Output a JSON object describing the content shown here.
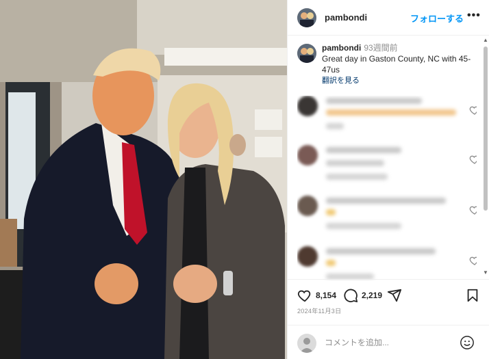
{
  "post": {
    "username": "pambondi",
    "follow_label": "フォローする",
    "more_label": "•••"
  },
  "caption": {
    "username": "pambondi",
    "time_ago": "93週間前",
    "text": "Great day in Gaston County, NC with 45-47us",
    "translate_label": "翻訳を見る"
  },
  "comments": [
    {
      "blurred": true
    },
    {
      "blurred": true
    },
    {
      "blurred": true
    },
    {
      "blurred": true
    }
  ],
  "actions": {
    "like_icon": "heart-icon",
    "like_count": "8,154",
    "comment_icon": "comment-icon",
    "comment_count": "2,219",
    "share_icon": "share-icon",
    "save_icon": "bookmark-icon"
  },
  "post_date": "2024年11月3日",
  "comment_box": {
    "placeholder": "コメントを追加...",
    "emoji_icon": "emoji-icon"
  },
  "colors": {
    "follow": "#0095f6",
    "translate": "#00376b",
    "meta_gray": "#8e8e8e"
  }
}
